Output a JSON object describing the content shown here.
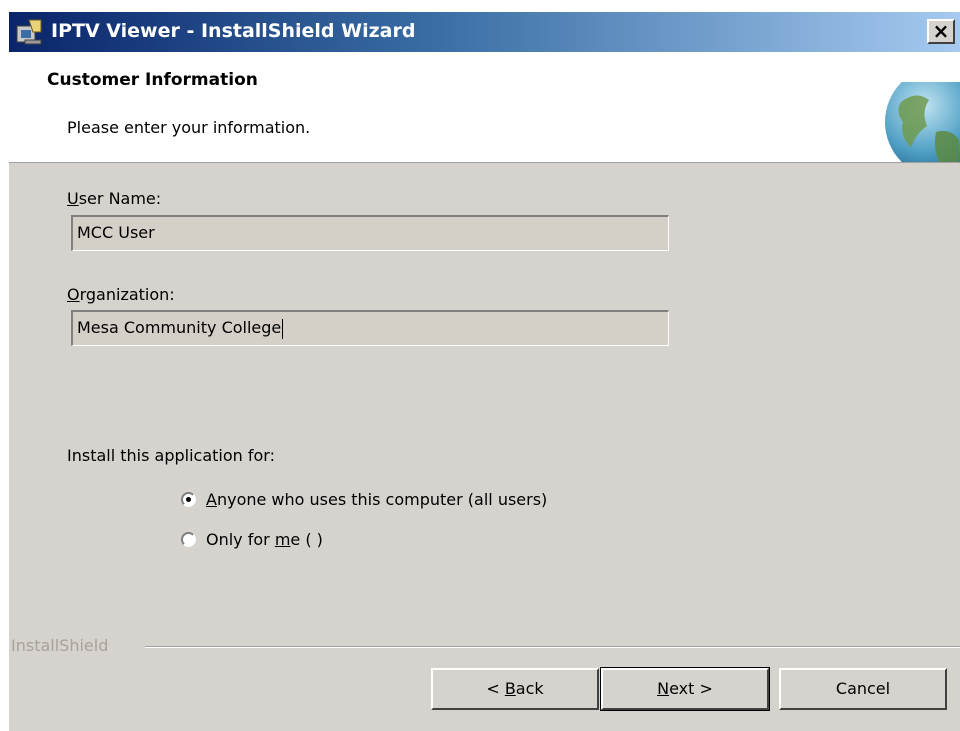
{
  "window": {
    "title": "IPTV Viewer - InstallShield Wizard",
    "close_label": "×"
  },
  "header": {
    "title": "Customer Information",
    "subtitle": "Please enter your information."
  },
  "form": {
    "user_name_label_mnemonic": "U",
    "user_name_label_rest": "ser Name:",
    "user_name_value": "MCC User",
    "organization_label_mnemonic": "O",
    "organization_label_rest": "rganization:",
    "organization_value": "Mesa Community College",
    "install_for_label": "Install this application for:",
    "options": [
      {
        "mnemonic": "A",
        "rest": "nyone who uses this computer (all users)",
        "selected": true
      },
      {
        "prefix": "Only for ",
        "mnemonic": "m",
        "rest": "e ( )",
        "selected": false
      }
    ]
  },
  "footer": {
    "brand": "InstallShield",
    "back_prefix": "< ",
    "back_mnemonic": "B",
    "back_rest": "ack",
    "next_mnemonic": "N",
    "next_rest": "ext >",
    "cancel_label": "Cancel"
  },
  "colors": {
    "titlebar_start": "#0a246a",
    "titlebar_end": "#a6caf0",
    "dialog_bg": "#d6d3ce"
  }
}
